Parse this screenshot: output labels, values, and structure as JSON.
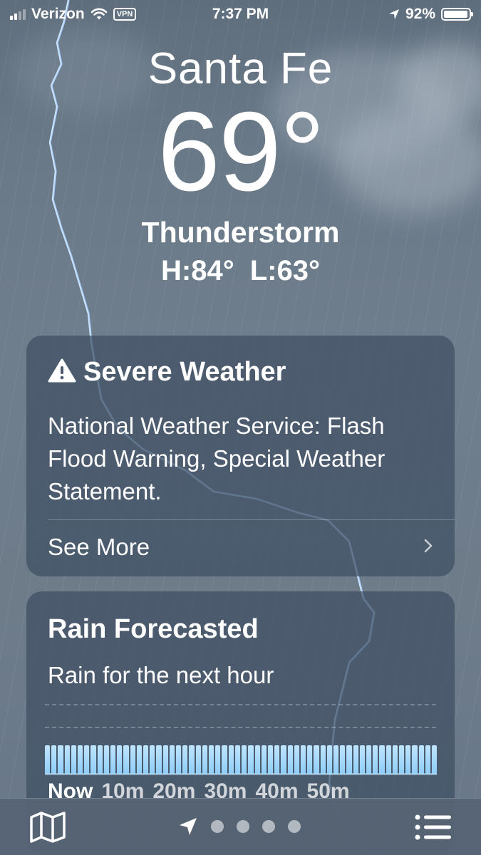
{
  "status_bar": {
    "carrier": "Verizon",
    "vpn": "VPN",
    "time": "7:37 PM",
    "battery": "92%",
    "battery_level": 0.92
  },
  "weather": {
    "city": "Santa Fe",
    "temperature": "69°",
    "condition": "Thunderstorm",
    "high": "H:84°",
    "low": "L:63°"
  },
  "alert": {
    "title": "Severe Weather",
    "body": "National Weather Service: Flash Flood Warning, Special Weather Statement.",
    "link": "See More"
  },
  "rain": {
    "title": "Rain Forecasted",
    "subtitle": "Rain for the next hour",
    "time_labels": [
      "Now",
      "10m",
      "20m",
      "30m",
      "40m",
      "50m"
    ]
  },
  "bottom_bar": {
    "icons": [
      "map-icon",
      "location-arrow-icon",
      "page-dot",
      "list-icon"
    ],
    "pages": 4
  },
  "colors": {
    "card_bg": "#3f4f62",
    "rain_bar": "#a8dbff",
    "background": "#6e7c8a"
  }
}
